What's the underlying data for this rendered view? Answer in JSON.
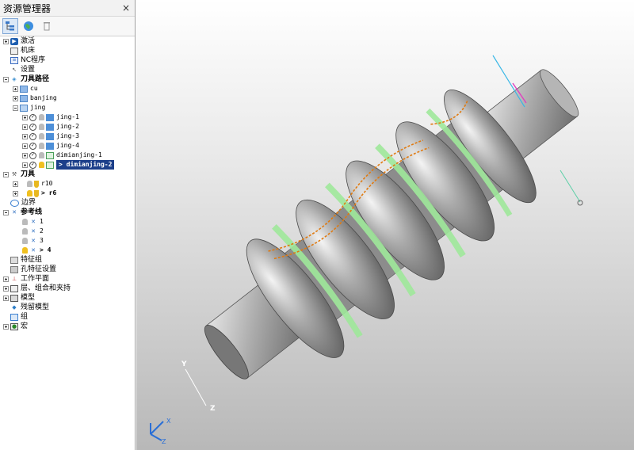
{
  "explorer": {
    "title": "资源管理器",
    "close_glyph": "×",
    "toolbar": [
      "explorer-tree-icon",
      "globe-icon",
      "trash-icon"
    ]
  },
  "tree": {
    "activation": "激活",
    "machine": "机床",
    "nc_program": "NC程序",
    "settings": "设置",
    "toolpaths": {
      "label": "刀具路径",
      "folders": [
        "cu",
        "banjing",
        "jing"
      ],
      "jing_items": [
        "jing-1",
        "jing-2",
        "jing-3",
        "jing-4",
        "dimianjing-1"
      ],
      "active_item": "> dimianjing-2"
    },
    "tools": {
      "label": "刀具",
      "items": [
        "r10"
      ],
      "active_item": "> r6"
    },
    "boundary": "边界",
    "pattern": {
      "label": "参考线",
      "items": [
        "1",
        "2",
        "3"
      ],
      "active_item": "> 4"
    },
    "feature_group": "特征组",
    "hole_feature": "孔特征设置",
    "workplane": "工作平面",
    "levels": "层、组合和夹持",
    "model": "模型",
    "stock_model": "残留模型",
    "group": "组",
    "macro": "宏"
  },
  "viewport": {
    "axis_labels": {
      "y": "Y",
      "z": "Z",
      "triad_x": "X",
      "triad_z": "Z"
    }
  },
  "colors": {
    "selection": "#1c3f8a",
    "toolpath_orange": "#e07a10",
    "toolpath_green": "#9fe89a",
    "part_grey": "#9a9a9a"
  }
}
